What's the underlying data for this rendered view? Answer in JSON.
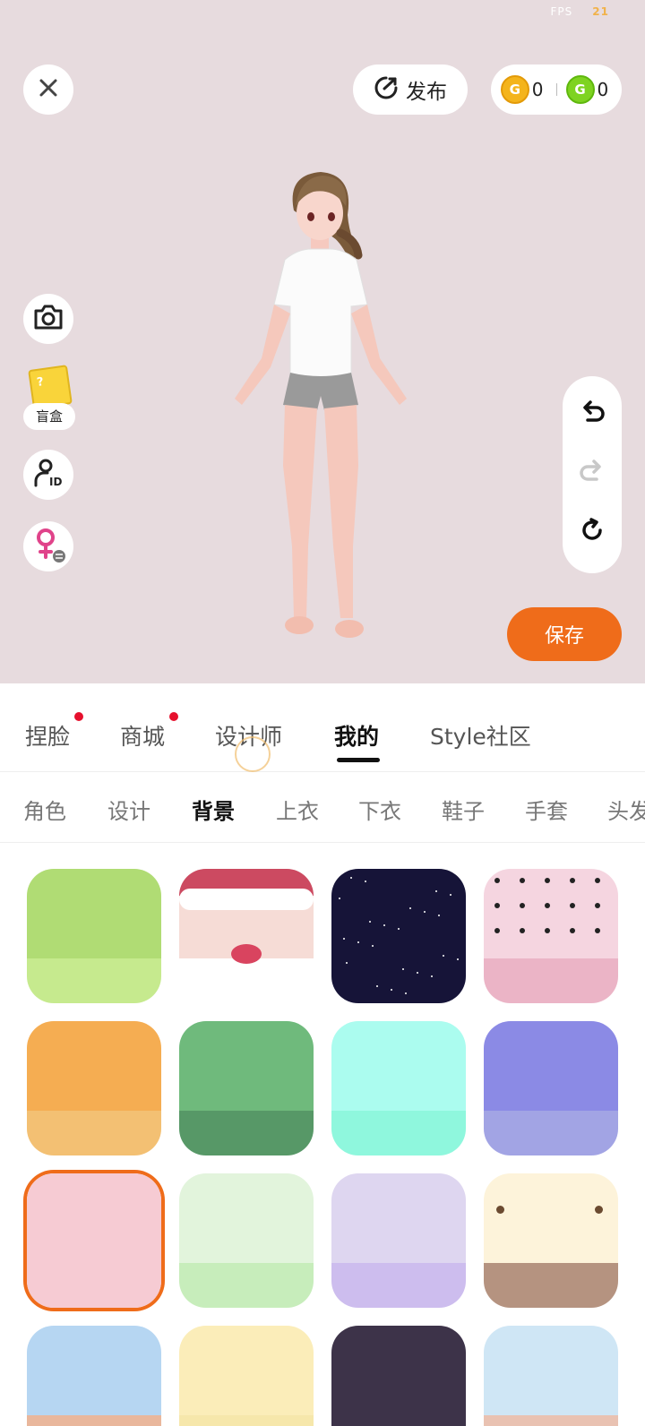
{
  "status": {
    "fps_label": "FPS",
    "fps_value": "21"
  },
  "header": {
    "publish_label": "发布",
    "coin_gold_value": "0",
    "coin_green_value": "0",
    "coin_gold_glyph": "G",
    "coin_green_glyph": "G"
  },
  "left_tools": {
    "blind_box_label": "盲盒"
  },
  "save_label": "保存",
  "main_tabs": [
    {
      "label": "捏脸",
      "badge": true
    },
    {
      "label": "商城",
      "badge": true
    },
    {
      "label": "设计师",
      "badge": false
    },
    {
      "label": "我的",
      "badge": false,
      "active": true
    },
    {
      "label": "Style社区",
      "badge": false
    }
  ],
  "sub_tabs": [
    {
      "label": "角色"
    },
    {
      "label": "设计"
    },
    {
      "label": "背景",
      "active": true
    },
    {
      "label": "上衣"
    },
    {
      "label": "下衣"
    },
    {
      "label": "鞋子"
    },
    {
      "label": "手套"
    },
    {
      "label": "头发"
    }
  ],
  "backgrounds": [
    {
      "name": "green",
      "top": "#b0dc74",
      "bottom": "#c6ea8e"
    },
    {
      "name": "santa",
      "top": "#f6dcd6",
      "bottom": "#ffffff"
    },
    {
      "name": "starry-night",
      "top": "#161438",
      "bottom": "#161438"
    },
    {
      "name": "pink-hearts",
      "top": "#f5d5e0",
      "bottom": "#ebb4c6"
    },
    {
      "name": "orange",
      "top": "#f5ad52",
      "bottom": "#f3c073"
    },
    {
      "name": "green-snow",
      "top": "#6fba7c",
      "bottom": "#579867"
    },
    {
      "name": "mint",
      "top": "#abfcef",
      "bottom": "#8ff7dd"
    },
    {
      "name": "purple",
      "top": "#8b8ae5",
      "bottom": "#a2a4e4"
    },
    {
      "name": "pink",
      "top": "#f6cbd3",
      "bottom": "#f6cbd3",
      "selected": true
    },
    {
      "name": "light-green-stars",
      "top": "#e2f4dc",
      "bottom": "#c7edbb"
    },
    {
      "name": "lavender-planets",
      "top": "#ded6f0",
      "bottom": "#cdbdee"
    },
    {
      "name": "cream-face",
      "top": "#fdf3da",
      "bottom": "#b59380"
    },
    {
      "name": "palace",
      "top": "#b6d6f2",
      "bottom": "#e9b79c"
    },
    {
      "name": "yellow-stripes",
      "top": "#fbedb9",
      "bottom": "#f6e7ab"
    },
    {
      "name": "dark-purple",
      "top": "#3d3349",
      "bottom": "#3d3349"
    },
    {
      "name": "window-room",
      "top": "#cfe6f5",
      "bottom": "#e9c2b2"
    }
  ]
}
